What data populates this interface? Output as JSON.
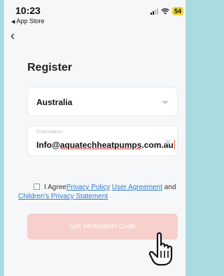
{
  "status_bar": {
    "time": "10:23",
    "back_app_label": "App Store",
    "battery": "54"
  },
  "nav": {
    "back_icon": "chevron-left-icon"
  },
  "page": {
    "title": "Register"
  },
  "country": {
    "value": "Australia"
  },
  "email": {
    "hint": "Email Address",
    "prefix": "Info@",
    "misspelled": "aquatechheatpumps",
    "suffix": ".com.au"
  },
  "agreement": {
    "prefix": "I Agree",
    "privacy_link": "Privacy Policy",
    "space": " ",
    "user_link": "User Agreement",
    "and": " and",
    "children_link": "Children's Privacy Statement"
  },
  "cta": {
    "label": "Get Verification Code"
  },
  "colors": {
    "accent_disabled": "#f7cfcb",
    "link": "#2a7bd3",
    "battery": "#f2d336"
  }
}
